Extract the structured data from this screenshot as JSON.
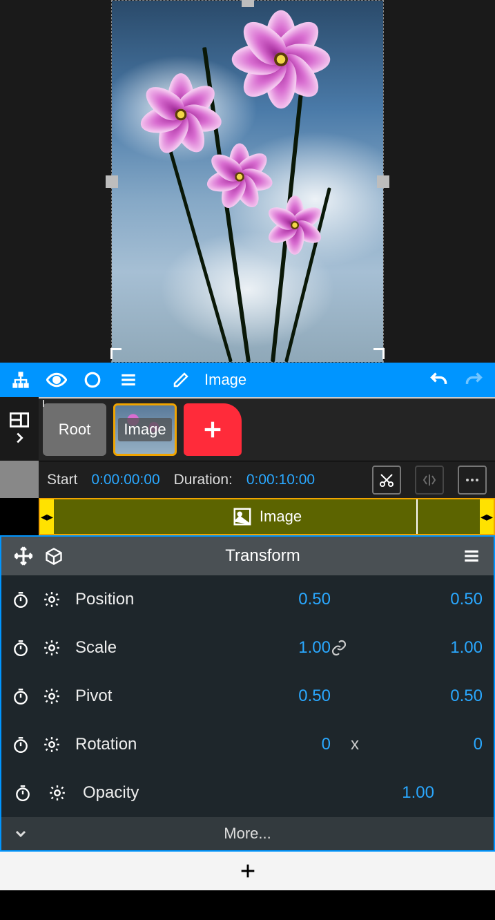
{
  "toolbar": {
    "title": "Image"
  },
  "layers": {
    "root_label": "Root",
    "image_label": "Image"
  },
  "timeline": {
    "start_label": "Start",
    "start_value": "0:00:00:00",
    "duration_label": "Duration:",
    "duration_value": "0:00:10:00",
    "clip_label": "Image"
  },
  "panel": {
    "title": "Transform",
    "more": "More..."
  },
  "props": {
    "position": {
      "label": "Position",
      "x": "0.50",
      "y": "0.50"
    },
    "scale": {
      "label": "Scale",
      "x": "1.00",
      "y": "1.00"
    },
    "pivot": {
      "label": "Pivot",
      "x": "0.50",
      "y": "0.50"
    },
    "rotation": {
      "label": "Rotation",
      "x": "0",
      "sep": "x",
      "y": "0"
    },
    "opacity": {
      "label": "Opacity",
      "v": "1.00"
    }
  }
}
